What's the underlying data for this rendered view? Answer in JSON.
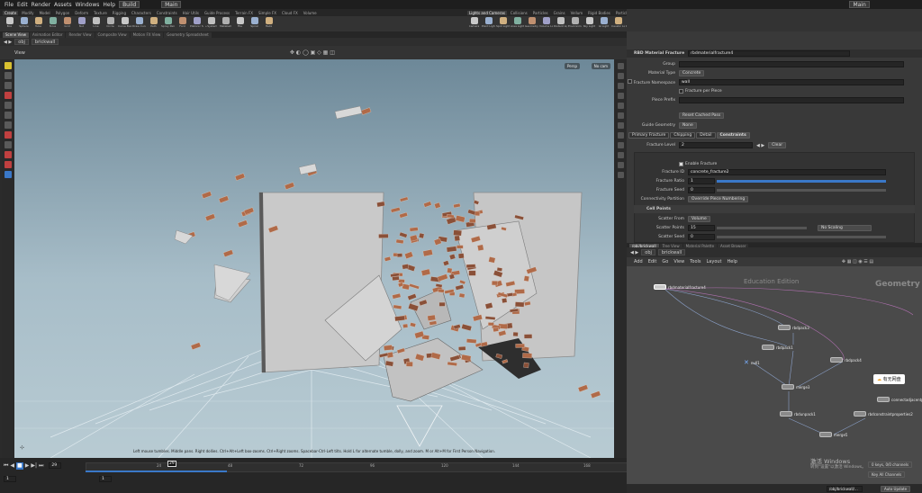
{
  "menubar": {
    "items": [
      "File",
      "Edit",
      "Render",
      "Assets",
      "Windows",
      "Help"
    ],
    "desktop": "Build",
    "context": "Main",
    "right_context": "Main"
  },
  "shelf_left": {
    "tabs": [
      "Create",
      "Modify",
      "Model",
      "Polygon",
      "Deform",
      "Texture",
      "Rigging",
      "Characters",
      "Constraints",
      "Hair Utils",
      "Guide Process",
      "Terrain FX",
      "Simple FX",
      "Cloud FX",
      "Volume"
    ],
    "tools": [
      "Box",
      "Sphere",
      "Tube",
      "Torus",
      "Grid",
      "Null",
      "Line",
      "Circle",
      "Curve Bezier",
      "Draw Curve",
      "Path",
      "Spray Paint",
      "Font",
      "Platonic Solids",
      "L-System",
      "Metaball",
      "File",
      "Spiral",
      "Helix"
    ]
  },
  "shelf_right": {
    "tabs": [
      "Lights and Cameras",
      "Collisions",
      "Particles",
      "Grains",
      "Vellum",
      "Rigid Bodies",
      "Particle Fluids",
      "Viscous Fluids",
      "Oceans",
      "Pyro FX",
      "FEM",
      "Wires",
      "Crowds",
      "Drive Simulation"
    ],
    "tools": [
      "Camera",
      "Point Light",
      "Spot Light",
      "Area Light",
      "Geometry Light",
      "Volume Light",
      "Distant Light",
      "Environment Light",
      "Sky Light",
      "GI Light",
      "Caustic Light",
      "Portal Light",
      "Ambient Light",
      "Stereo Camera",
      "VR Camera",
      "Switcher",
      "Gamepad Camera"
    ]
  },
  "viewport": {
    "pane_tabs": [
      "Scene View",
      "Animation Editor",
      "Render View",
      "Composite View",
      "Motion FX View",
      "Geometry Spreadsheet"
    ],
    "path": [
      "obj",
      "brickwall"
    ],
    "label": "View",
    "camera": "Persp",
    "cam_menu": "No cam",
    "hint": "Left mouse tumbles. Middle pans. Right dollies. Ctrl+Alt+Left box-zooms. Ctrl+Right zooms. Spacebar-Ctrl-Left tilts. Hold L for alternate tumble, dolly, and zoom.    M or Alt+M for First Person Navigation."
  },
  "timeline": {
    "frame": "29",
    "start": "1",
    "start2": "1",
    "end": "240",
    "end2": "240",
    "ticks": [
      "24",
      "48",
      "72",
      "96",
      "120",
      "144",
      "168",
      "192",
      "216"
    ],
    "key_label": "0 keys, 0/0 channels",
    "channels_button": "Key All Channels",
    "auto_update": "Auto Update",
    "path_display": "/obj/brickwall/..."
  },
  "param_panel": {
    "pane_tabs": [
      "rbdMaterialFracture4",
      "Take List",
      "Performance Monitor"
    ],
    "path": [
      "obj",
      "brickwall"
    ],
    "node_type": "RBD Material Fracture",
    "node_name": "rbdmaterialfracture4",
    "group_label": "Group",
    "material_type_label": "Material Type",
    "material_type": "Concrete",
    "fracture_namespace_label": "Fracture Namespace",
    "fracture_namespace": "wall",
    "fracture_per_piece": "Fracture per Piece",
    "piece_prefix_label": "Piece Prefix",
    "reset_cached": "Reset Cached Pass",
    "guide_geometry_label": "Guide Geometry",
    "guide_geometry": "None",
    "tabs": [
      "Primary Fracture",
      "Chipping",
      "Detail",
      "Constraints"
    ],
    "fracture_level_label": "Fracture Level",
    "fracture_level": "2",
    "clear": "Clear",
    "enable_fracture": "Enable Fracture",
    "fracture_id_label": "Fracture ID",
    "fracture_id": "concrete_fracture2",
    "fracture_ratio_label": "Fracture Ratio",
    "fracture_ratio": "1",
    "fracture_seed_label": "Fracture Seed",
    "fracture_seed": "0",
    "connectivity_label": "Connectivity Partition",
    "connectivity": "Override Piece Numbering",
    "cell_points": "Cell Points",
    "scatter_from_label": "Scatter From",
    "scatter_from": "Volume",
    "scatter_points_label": "Scatter Points",
    "scatter_points": "15",
    "scaling": "No Scaling",
    "scatter_seed_label": "Scatter Seed",
    "scatter_seed": "0"
  },
  "network": {
    "pane_tabs": [
      "/obj/brickwall",
      "Tree View",
      "Material Palette",
      "Asset Browser"
    ],
    "path": [
      "obj",
      "brickwall"
    ],
    "menu": [
      "Add",
      "Edit",
      "Go",
      "View",
      "Tools",
      "Layout",
      "Help"
    ],
    "watermark1": "Education Edition",
    "watermark2": "Geometry",
    "nodes": [
      "rbdmaterialfracture4",
      "rbdpack3",
      "rbdpack1",
      "rbdpack4",
      "null1",
      "merge3",
      "rbdunpack1",
      "rbdconstraintproperties2",
      "connectadjacentpieces",
      "merge5"
    ],
    "badge": "有无网盘",
    "activate1": "激活 Windows",
    "activate2": "转到\"设置\"以激活 Windows。"
  },
  "colors": {
    "accent": "#3a78c8",
    "selected_tab": "#4a4a4a",
    "brick": "#b06a48"
  }
}
